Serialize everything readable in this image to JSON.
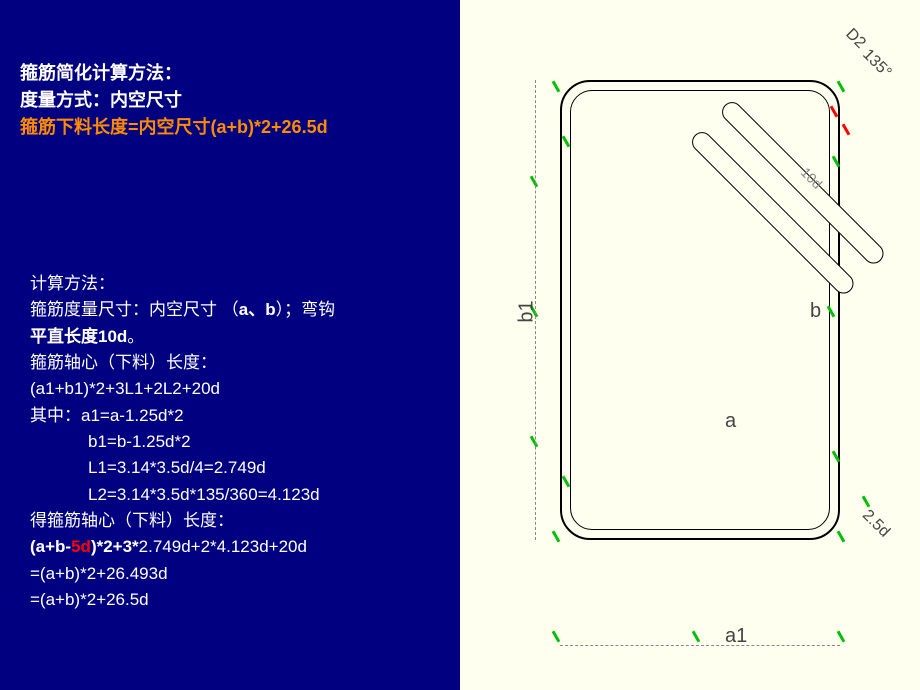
{
  "header": {
    "line1": "箍筋简化计算方法：",
    "line2": "度量方式：内空尺寸",
    "line3": "箍筋下料长度=内空尺寸(a+b)*2+26.5d"
  },
  "calc": {
    "title": "计算方法：",
    "measure_prefix": "箍筋度量尺寸：内空尺寸 （",
    "measure_ab": "a、b",
    "measure_mid": "）；弯钩",
    "measure_suffix_prefix": "平直长度",
    "measure_10d": "10d",
    "measure_period": "。",
    "axis_label": "箍筋轴心（下料）长度：",
    "axis_formula": "(a1+b1)*2+3L1+2L2+20d",
    "where": "其中：a1=a-1.25d*2",
    "b1": "b1=b-1.25d*2",
    "l1": "L1=3.14*3.5d/4=2.749d",
    "l2": "L2=3.14*3.5d*135/360=4.123d",
    "result_label": "得箍筋轴心（下料）长度：",
    "result_f1_a": "(a+b-",
    "result_f1_5d": "5d",
    "result_f1_b": ")*2+3*",
    "result_f1_c": "2.749d+2*4.123d+20d",
    "result_f2": "=(a+b)*2+26.493d",
    "result_f3": "=(a+b)*2+26.5d"
  },
  "diagram": {
    "label_a": "a",
    "label_b": "b",
    "label_a1": "a1",
    "label_b1": "b1",
    "label_25d": "2.5d",
    "label_135": "135°",
    "label_d2": "D2",
    "label_10d": "10d"
  }
}
